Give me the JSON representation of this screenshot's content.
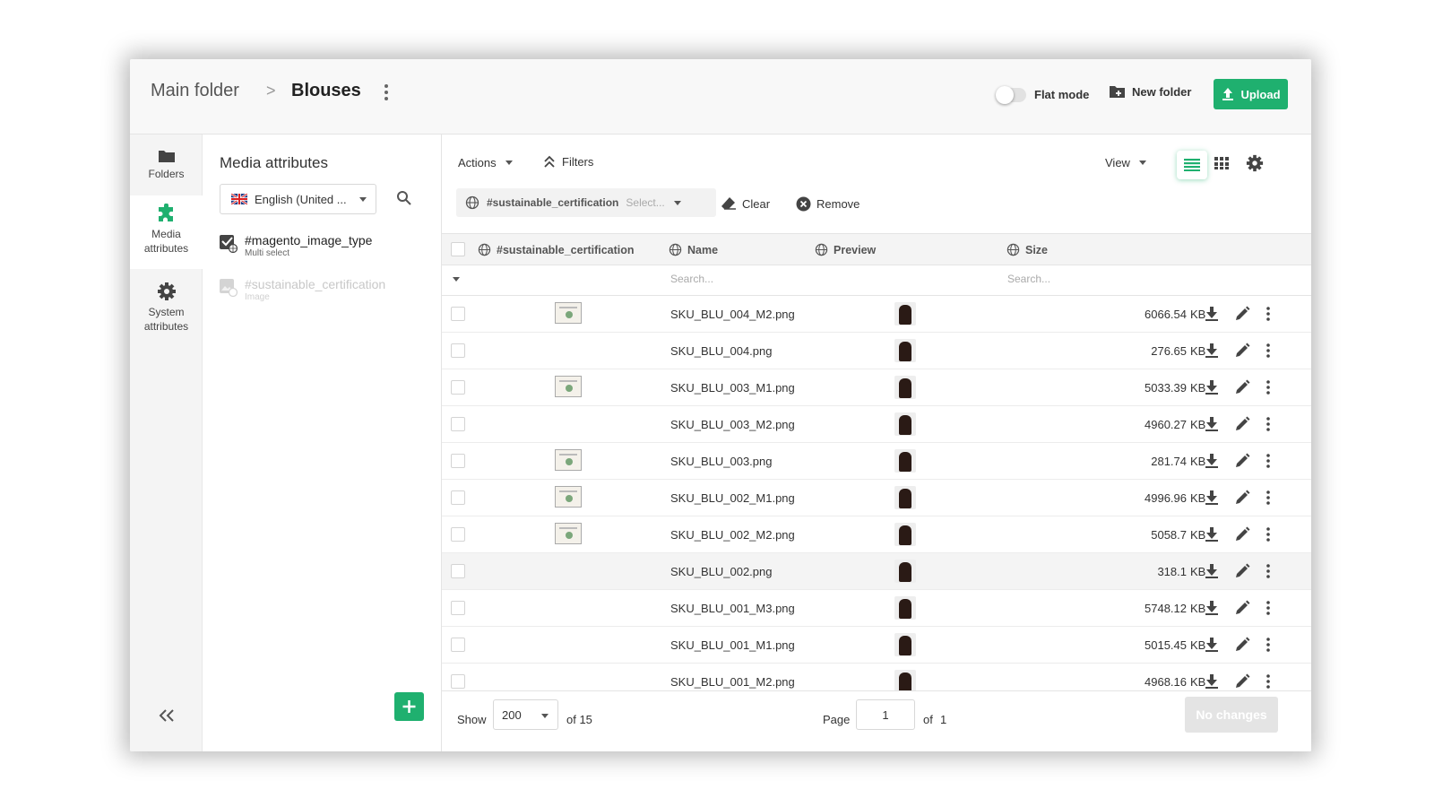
{
  "header": {
    "breadcrumb_root": "Main folder",
    "breadcrumb_separator": ">",
    "breadcrumb_current": "Blouses",
    "flat_mode_label": "Flat mode",
    "new_folder_label": "New folder",
    "upload_label": "Upload"
  },
  "rail": {
    "folders_label": "Folders",
    "media_attributes_label_1": "Media",
    "media_attributes_label_2": "attributes",
    "system_attributes_label_1": "System",
    "system_attributes_label_2": "attributes"
  },
  "attribute_panel": {
    "title": "Media attributes",
    "language": "English (United ...",
    "items": [
      {
        "name": "#magento_image_type",
        "type": "Multi select"
      },
      {
        "name": "#sustainable_certification",
        "type": "Image"
      }
    ]
  },
  "toolbar": {
    "actions_label": "Actions",
    "filters_label": "Filters",
    "view_label": "View"
  },
  "filter": {
    "attribute": "#sustainable_certification",
    "select_placeholder": "Select...",
    "clear_label": "Clear",
    "remove_label": "Remove"
  },
  "table": {
    "columns": {
      "certification": "#sustainable_certification",
      "name": "Name",
      "preview": "Preview",
      "size": "Size"
    },
    "search_placeholder": "Search...",
    "rows": [
      {
        "name": "SKU_BLU_004_M2.png",
        "size": "6066.54",
        "unit": "KB"
      },
      {
        "name": "SKU_BLU_004.png",
        "size": "276.65",
        "unit": "KB"
      },
      {
        "name": "SKU_BLU_003_M1.png",
        "size": "5033.39",
        "unit": "KB"
      },
      {
        "name": "SKU_BLU_003_M2.png",
        "size": "4960.27",
        "unit": "KB"
      },
      {
        "name": "SKU_BLU_003.png",
        "size": "281.74",
        "unit": "KB"
      },
      {
        "name": "SKU_BLU_002_M1.png",
        "size": "4996.96",
        "unit": "KB"
      },
      {
        "name": "SKU_BLU_002_M2.png",
        "size": "5058.7",
        "unit": "KB"
      },
      {
        "name": "SKU_BLU_002.png",
        "size": "318.1",
        "unit": "KB"
      },
      {
        "name": "SKU_BLU_001_M3.png",
        "size": "5748.12",
        "unit": "KB"
      },
      {
        "name": "SKU_BLU_001_M1.png",
        "size": "5015.45",
        "unit": "KB"
      },
      {
        "name": "SKU_BLU_001_M2.png",
        "size": "4968.16",
        "unit": "KB"
      }
    ]
  },
  "footer": {
    "show_label": "Show",
    "page_size": "200",
    "of_total": "of 15",
    "page_label": "Page",
    "page_value": "1",
    "page_of": "of",
    "page_total": "1",
    "no_changes_label": "No changes"
  },
  "colors": {
    "accent": "#1fb06f",
    "disabled": "#e4e4e4"
  }
}
